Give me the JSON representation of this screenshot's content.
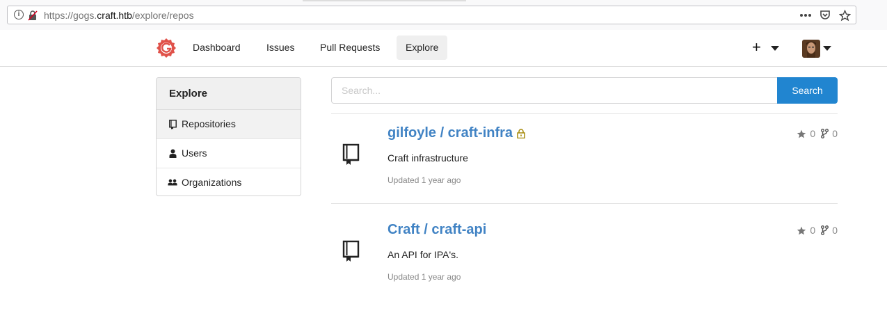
{
  "browser": {
    "url_prefix": "https://gogs.",
    "url_domain": "craft.htb",
    "url_path": "/explore/repos",
    "actions": [
      "more-icon",
      "pocket-icon",
      "star-icon"
    ]
  },
  "navbar": {
    "items": [
      {
        "label": "Dashboard",
        "active": false
      },
      {
        "label": "Issues",
        "active": false
      },
      {
        "label": "Pull Requests",
        "active": false
      },
      {
        "label": "Explore",
        "active": true
      }
    ],
    "plus": "+"
  },
  "sidebar": {
    "title": "Explore",
    "items": [
      {
        "label": "Repositories",
        "icon": "repo-icon",
        "active": true
      },
      {
        "label": "Users",
        "icon": "person-icon",
        "active": false
      },
      {
        "label": "Organizations",
        "icon": "organization-icon",
        "active": false
      }
    ]
  },
  "search": {
    "placeholder": "Search...",
    "button": "Search"
  },
  "repos": [
    {
      "name": "gilfoyle / craft-infra",
      "private": true,
      "description": "Craft infrastructure",
      "updated": "Updated 1 year ago",
      "stars": "0",
      "forks": "0"
    },
    {
      "name": "Craft / craft-api",
      "private": false,
      "description": "An API for IPA's.",
      "updated": "Updated 1 year ago",
      "stars": "0",
      "forks": "0"
    }
  ],
  "colors": {
    "accent": "#2185d0",
    "link": "#4183c4",
    "logo": "#e0524a",
    "lock": "#a68a0b"
  }
}
